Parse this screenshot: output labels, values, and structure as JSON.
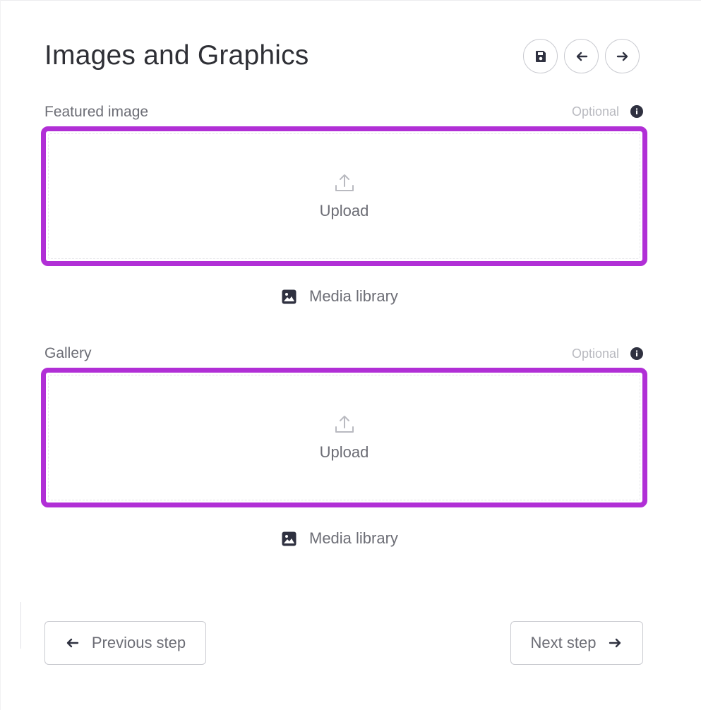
{
  "header": {
    "title": "Images and Graphics",
    "actions": [
      "save-icon",
      "arrow-left-icon",
      "arrow-right-icon"
    ]
  },
  "featured_image": {
    "label": "Featured image",
    "optional": "Optional",
    "upload_label": "Upload",
    "media_library_label": "Media library"
  },
  "gallery": {
    "label": "Gallery",
    "optional": "Optional",
    "upload_label": "Upload",
    "media_library_label": "Media library"
  },
  "footer": {
    "previous_label": "Previous step",
    "next_label": "Next step"
  },
  "colors": {
    "highlight": "#b12fd6",
    "text_dark": "#2f3036",
    "text_muted": "#6c6d75",
    "icon_dark": "#2f3140"
  }
}
